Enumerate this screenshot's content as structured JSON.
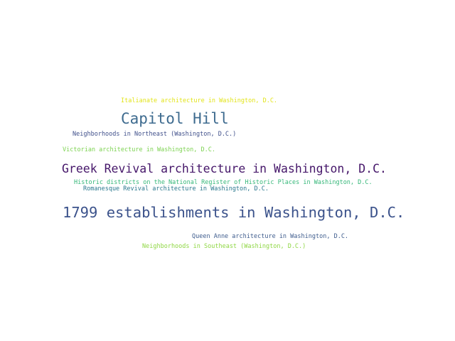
{
  "words": [
    {
      "text": "Italianate architecture in Washington, D.C.",
      "color": "#e2e418"
    },
    {
      "text": "Capitol Hill",
      "color": "#3e6b8f"
    },
    {
      "text": "Neighborhoods in Northeast (Washington, D.C.)",
      "color": "#3f4f8a"
    },
    {
      "text": "Victorian architecture in Washington, D.C.",
      "color": "#7cd250"
    },
    {
      "text": "Greek Revival architecture in Washington, D.C.",
      "color": "#46176a"
    },
    {
      "text": "Historic districts on the National Register of Historic Places in Washington, D.C.",
      "color": "#35b779"
    },
    {
      "text": "Romanesque Revival architecture in Washington, D.C.",
      "color": "#2a788e"
    },
    {
      "text": "1799 establishments in Washington, D.C.",
      "color": "#3b528b"
    },
    {
      "text": "Queen Anne architecture in Washington, D.C.",
      "color": "#3e5c8d"
    },
    {
      "text": "Neighborhoods in Southeast (Washington, D.C.)",
      "color": "#8fd744"
    }
  ]
}
